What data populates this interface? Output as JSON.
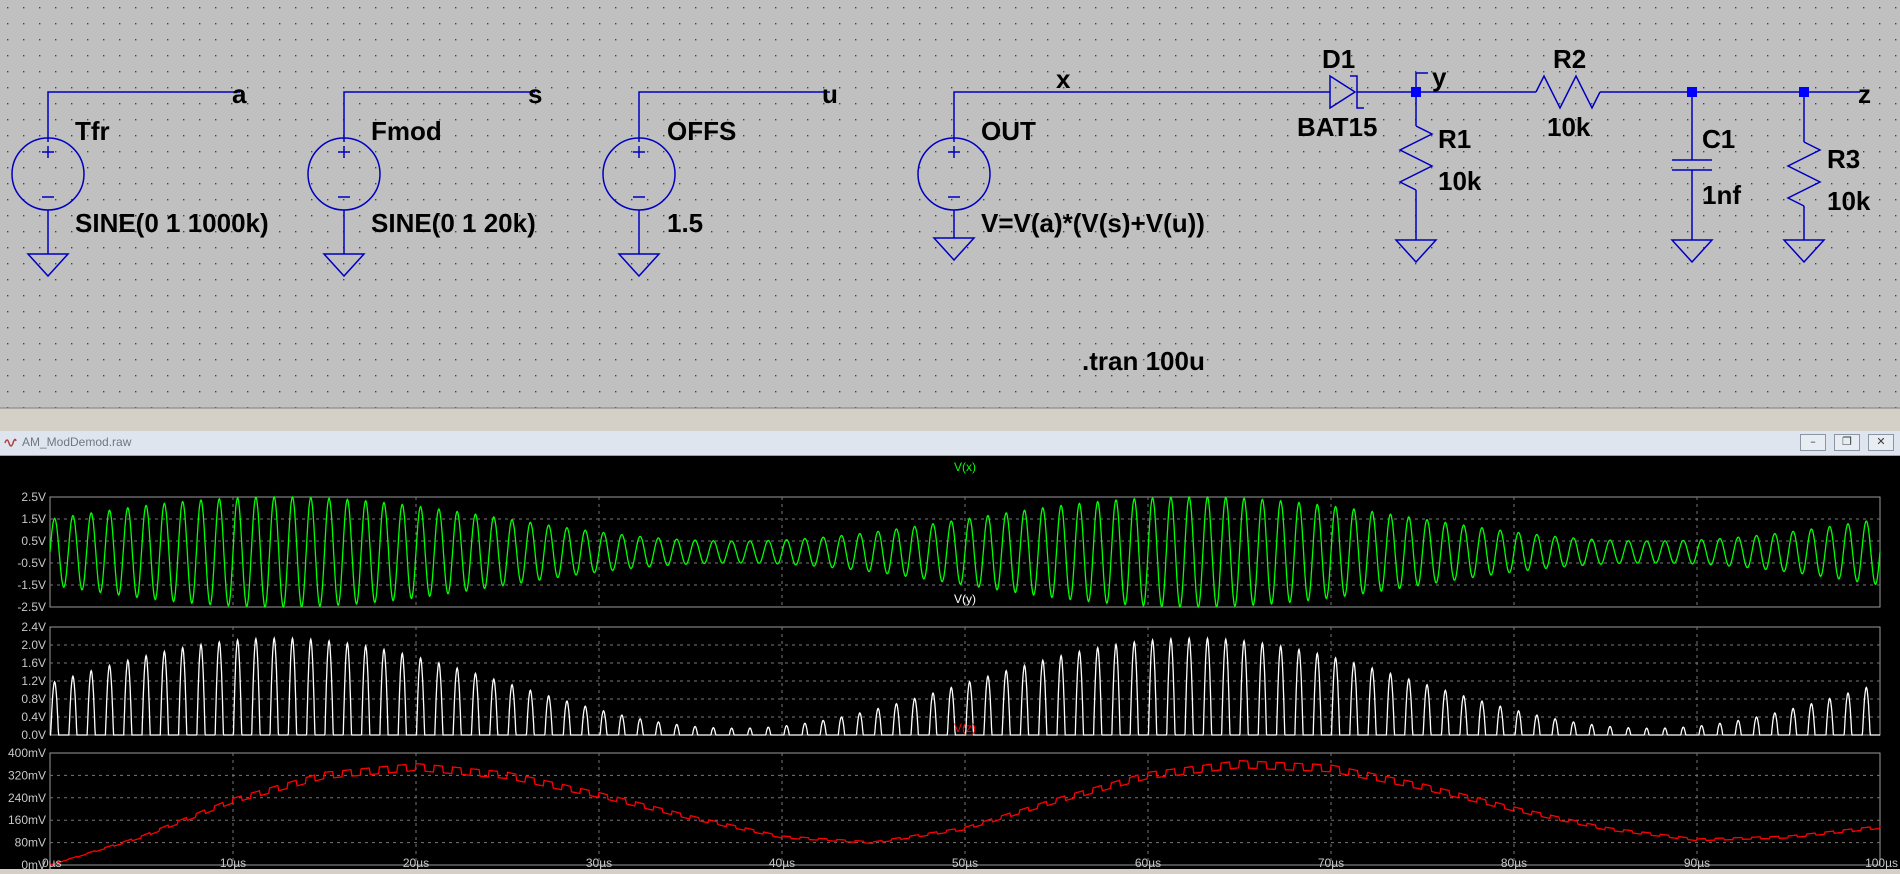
{
  "schematic": {
    "nets": [
      "a",
      "s",
      "u",
      "x",
      "y",
      "z"
    ],
    "sources": [
      {
        "name": "Tfr",
        "value": "SINE(0 1 1000k)"
      },
      {
        "name": "Fmod",
        "value": "SINE(0 1 20k)"
      },
      {
        "name": "OFFS",
        "value": "1.5"
      },
      {
        "name": "OUT",
        "value": "V=V(a)*(V(s)+V(u))"
      }
    ],
    "components": [
      {
        "name": "D1",
        "value": "BAT15"
      },
      {
        "name": "R1",
        "value": "10k"
      },
      {
        "name": "R2",
        "value": "10k"
      },
      {
        "name": "C1",
        "value": "1nf"
      },
      {
        "name": "R3",
        "value": "10k"
      }
    ],
    "directive": ".tran 100u",
    "colors": {
      "background": "#c0c0c0",
      "wire": "#0000c0",
      "text": "#000000",
      "dot": "#000000"
    }
  },
  "waveform_window": {
    "title": "AM_ModDemod.raw",
    "buttons": {
      "minimize": "–",
      "restore": "❐",
      "close": "✕"
    }
  },
  "chart_data": [
    {
      "type": "line",
      "title": "V(x)",
      "color": "#00ff00",
      "yticks": [
        "2.5V",
        "1.5V",
        "0.5V",
        "-0.5V",
        "-1.5V",
        "-2.5V"
      ],
      "ylim": [
        -2.5,
        2.5
      ],
      "xlim": [
        0,
        100
      ],
      "x_unit": "µs",
      "formula": "(sin(2π·0.02·t)+1.5)·sin(2π·1.0·t)",
      "carrier_mhz": 1.0,
      "mod_khz": 20,
      "offset": 1.5
    },
    {
      "type": "line",
      "title": "V(y)",
      "color": "#ffffff",
      "yticks": [
        "2.4V",
        "2.0V",
        "1.6V",
        "1.2V",
        "0.8V",
        "0.4V",
        "0.0V"
      ],
      "ylim": [
        0,
        2.4
      ],
      "xlim": [
        0,
        100
      ],
      "x_unit": "µs",
      "peak_max": 2.2,
      "peak_min": 0.2
    },
    {
      "type": "line",
      "title": "V(z)",
      "color": "#ff0000",
      "yticks": [
        "400mV",
        "320mV",
        "240mV",
        "160mV",
        "80mV",
        "0mV"
      ],
      "ylim": [
        0,
        400
      ],
      "y_unit": "mV",
      "xlim": [
        0,
        100
      ],
      "x_unit": "µs",
      "samples": [
        [
          0,
          0
        ],
        [
          2,
          40
        ],
        [
          5,
          100
        ],
        [
          10,
          230
        ],
        [
          15,
          320
        ],
        [
          20,
          350
        ],
        [
          25,
          320
        ],
        [
          30,
          250
        ],
        [
          35,
          170
        ],
        [
          40,
          100
        ],
        [
          45,
          80
        ],
        [
          50,
          130
        ],
        [
          55,
          230
        ],
        [
          60,
          320
        ],
        [
          65,
          360
        ],
        [
          70,
          345
        ],
        [
          75,
          280
        ],
        [
          80,
          200
        ],
        [
          85,
          130
        ],
        [
          90,
          90
        ],
        [
          95,
          100
        ],
        [
          100,
          135
        ]
      ]
    }
  ],
  "x_axis": {
    "ticks": [
      "0µs",
      "10µs",
      "20µs",
      "30µs",
      "40µs",
      "50µs",
      "60µs",
      "70µs",
      "80µs",
      "90µs",
      "100µs"
    ]
  }
}
